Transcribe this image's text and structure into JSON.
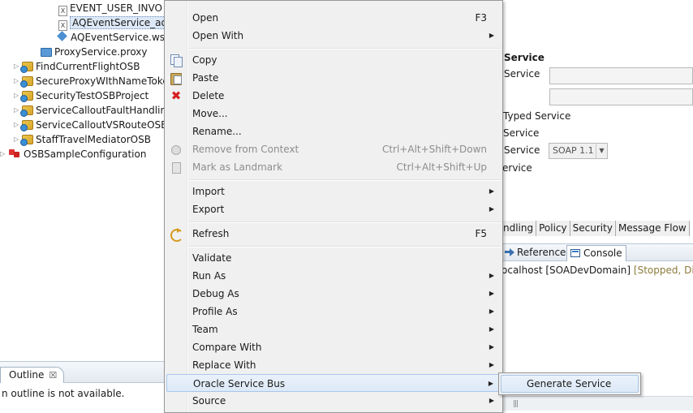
{
  "project_tree": {
    "items": [
      {
        "label": "EVENT_USER_INVO",
        "icon": "xml-file-icon",
        "expandable": false
      },
      {
        "label": "AQEventService_aq.jca",
        "icon": "xml-file-icon",
        "expandable": false,
        "selected": true
      },
      {
        "label": "AQEventService.wsdl",
        "icon": "wsdl-icon",
        "expandable": false
      },
      {
        "label": "ProxyService.proxy",
        "icon": "proxy-service-icon",
        "expandable": false
      },
      {
        "label": "FindCurrentFlightOSB",
        "icon": "osb-project-icon",
        "expandable": true
      },
      {
        "label": "SecureProxyWIthNameToken",
        "icon": "osb-project-icon",
        "expandable": true
      },
      {
        "label": "SecurityTestOSBProject",
        "icon": "osb-project-icon",
        "expandable": true
      },
      {
        "label": "ServiceCalloutFaultHandling",
        "icon": "osb-project-icon",
        "expandable": true
      },
      {
        "label": "ServiceCalloutVSRouteOSB",
        "icon": "osb-project-icon",
        "expandable": true
      },
      {
        "label": "StaffTravelMediatorOSB",
        "icon": "osb-project-icon",
        "expandable": true
      },
      {
        "label": "OSBSampleConfiguration",
        "icon": "osb-configuration-icon",
        "expandable": true
      }
    ]
  },
  "outline": {
    "tab_label": "Outline",
    "close_glyph": "☒",
    "message": "n outline is not available."
  },
  "editor": {
    "section_title": "Service",
    "labels": {
      "service_type": "Service",
      "typed_service": "Typed Service",
      "service": "Service",
      "soap_service": "Service",
      "messaging_service": "ervice"
    },
    "soap_version": "SOAP 1.1",
    "tabs": [
      "ndling",
      "Policy",
      "Security",
      "Message Flow"
    ],
    "bottom_tabs": {
      "references": "References",
      "console": "Console"
    },
    "server_name": "ocalhost [SOADevDomain]",
    "server_status": "[Stopped, Direct"
  },
  "context_menu": {
    "items": [
      {
        "label": "Open",
        "accelerator": "F3"
      },
      {
        "label": "Open With",
        "submenu": true
      },
      {
        "label": "Copy",
        "icon": "copy-icon"
      },
      {
        "label": "Paste",
        "icon": "paste-icon"
      },
      {
        "label": "Delete",
        "icon": "delete-icon"
      },
      {
        "label": "Move..."
      },
      {
        "label": "Rename..."
      },
      {
        "label": "Remove from Context",
        "accelerator": "Ctrl+Alt+Shift+Down",
        "disabled": true,
        "icon": "remove-context-icon"
      },
      {
        "label": "Mark as Landmark",
        "accelerator": "Ctrl+Alt+Shift+Up",
        "disabled": true,
        "icon": "landmark-icon"
      },
      {
        "label": "Import",
        "submenu": true
      },
      {
        "label": "Export",
        "submenu": true
      },
      {
        "label": "Refresh",
        "accelerator": "F5",
        "icon": "refresh-icon"
      },
      {
        "label": "Validate"
      },
      {
        "label": "Run As",
        "submenu": true
      },
      {
        "label": "Debug As",
        "submenu": true
      },
      {
        "label": "Profile As",
        "submenu": true
      },
      {
        "label": "Team",
        "submenu": true
      },
      {
        "label": "Compare With",
        "submenu": true
      },
      {
        "label": "Replace With",
        "submenu": true
      },
      {
        "label": "Oracle Service Bus",
        "submenu": true,
        "highlighted": true
      },
      {
        "label": "Source",
        "submenu": true
      }
    ],
    "submenu_glyph": "▶"
  },
  "submenu": {
    "items": [
      {
        "label": "Generate Service",
        "highlighted": true
      }
    ]
  },
  "colors": {
    "menu_background": "#f0f0f0",
    "highlight": "#dde9f7",
    "highlight_border": "#a8c7ea",
    "disabled_text": "#8d8d8d",
    "delete_icon": "#d62020"
  }
}
